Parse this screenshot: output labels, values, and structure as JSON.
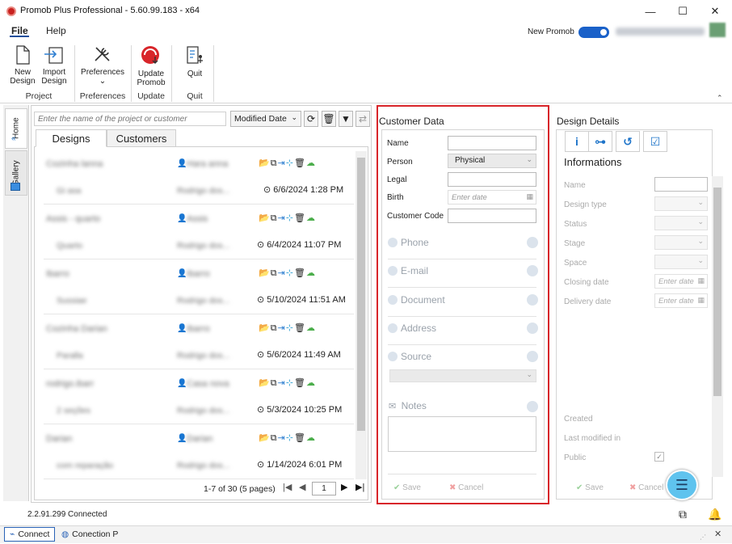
{
  "window": {
    "title": "Promob Plus Professional - 5.60.99.183 - x64",
    "minimize": "—",
    "maximize": "☐",
    "close": "✕"
  },
  "menu": {
    "file": "File",
    "help": "Help",
    "new_promob_label": "New Promob",
    "new_promob_on": true
  },
  "ribbon": {
    "buttons": [
      {
        "label1": "New",
        "label2": "Design"
      },
      {
        "label1": "Import",
        "label2": "Design"
      },
      {
        "label1": "Preferences",
        "label2": "⌄"
      },
      {
        "label1": "Update",
        "label2": "Promob"
      },
      {
        "label1": "Quit",
        "label2": ""
      }
    ],
    "groups": [
      "Project",
      "Preferences",
      "Update",
      "Quit"
    ]
  },
  "sidetabs": {
    "home": "Home",
    "gallery": "Gallery"
  },
  "designs": {
    "search_placeholder": "Enter the name of the project or customer",
    "sort": "Modified Date",
    "tabs": [
      "Designs",
      "Customers"
    ],
    "rows": [
      {
        "name": "Cozinha lanna",
        "owner": "Hara anna",
        "sub": "Gi asa",
        "author": "Rodrigo dos...",
        "date": "6/6/2024 1:28 PM"
      },
      {
        "name": "Assis - quarto",
        "owner": "Assis",
        "sub": "Quarto",
        "author": "Rodrigo dos...",
        "date": "6/4/2024 11:07 PM"
      },
      {
        "name": "Ibarro",
        "owner": "Ibarro",
        "sub": "Sussiae",
        "author": "Rodrigo dos...",
        "date": "5/10/2024 11:51 AM"
      },
      {
        "name": "Cozinha Darian",
        "owner": "Ibarro",
        "sub": "Paralla",
        "author": "Rodrigo dos...",
        "date": "5/6/2024 11:49 AM"
      },
      {
        "name": "rodrigo.ibarr",
        "owner": "Casa nova",
        "sub": "2 seções",
        "author": "Rodrigo dos...",
        "date": "5/3/2024 10:25 PM"
      },
      {
        "name": "Darian",
        "owner": "Darian",
        "sub": "com reparação",
        "author": "Rodrigo dos...",
        "date": "1/14/2024 6:01 PM"
      }
    ],
    "pager": "1-7 of 30 (5 pages)",
    "page": "1"
  },
  "customer": {
    "title": "Customer Data",
    "name_label": "Name",
    "person_label": "Person",
    "person_value": "Physical",
    "legal_label": "Legal",
    "birth_label": "Birth",
    "birth_placeholder": "Enter date",
    "code_label": "Customer Code",
    "sections": [
      "Phone",
      "E-mail",
      "Document",
      "Address",
      "Source"
    ],
    "notes": "Notes",
    "save": "Save",
    "cancel": "Cancel"
  },
  "design_details": {
    "title": "Design Details",
    "info_title": "Informations",
    "labels": [
      "Name",
      "Design type",
      "Status",
      "Stage",
      "Space",
      "Closing date",
      "Delivery date"
    ],
    "date_placeholder": "Enter date",
    "created": "Created",
    "last_modified": "Last modified in",
    "public": "Public",
    "save": "Save",
    "cancel": "Cancel"
  },
  "status": {
    "version": "2.2.91.299 Connected",
    "connect_tab": "Connect",
    "connection_tab": "Conection P"
  },
  "colors": {
    "accent": "#1a61c9",
    "highlight": "#d8252a",
    "fab": "#5fc3ee"
  }
}
